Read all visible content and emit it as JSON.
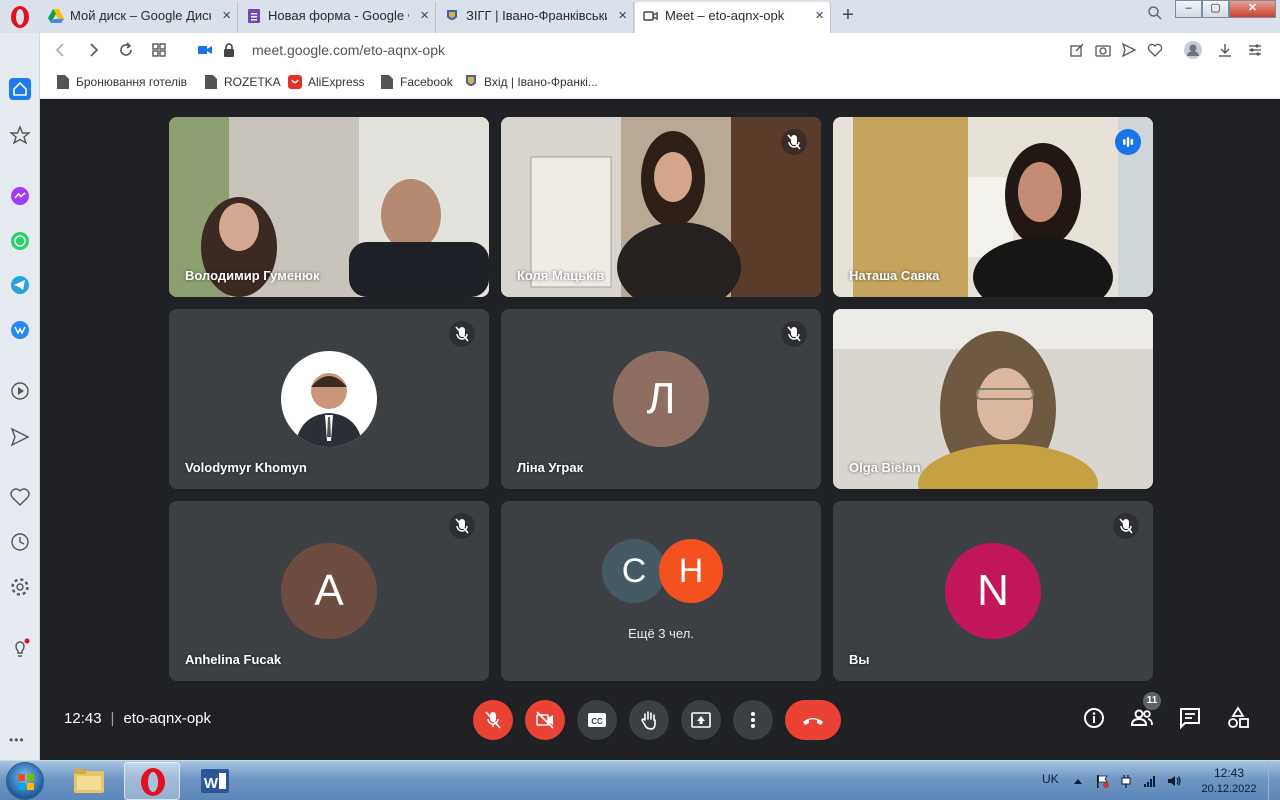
{
  "browser": {
    "tabs": [
      {
        "title": "Мой диск – Google Диск",
        "icon": "google-drive-icon",
        "active": false
      },
      {
        "title": "Новая форма - Google Фо",
        "icon": "google-forms-icon",
        "active": false
      },
      {
        "title": "ЗІГГ | Івано-Франківський",
        "icon": "crest-icon",
        "active": false
      },
      {
        "title": "Meet – eto-aqnx-opk",
        "icon": "meet-icon",
        "active": true
      }
    ],
    "close_glyph": "×",
    "new_tab_glyph": "+",
    "url": "meet.google.com/eto-aqnx-opk",
    "bookmarks": [
      {
        "label": "Бронювання готелів",
        "icon": "page-icon"
      },
      {
        "label": "ROZETKA",
        "icon": "page-icon"
      },
      {
        "label": "AliExpress",
        "icon": "aliexpress-icon"
      },
      {
        "label": "Facebook",
        "icon": "page-icon"
      },
      {
        "label": "Вхід | Івано-Франкі...",
        "icon": "crest-icon"
      }
    ],
    "window_buttons": {
      "minimize": "–",
      "maximize": "▢",
      "close": "✕"
    }
  },
  "sidebar": {
    "more_label": "•••"
  },
  "meet": {
    "participants": [
      {
        "name": "Володимир Гуменюк",
        "type": "video",
        "muted": false
      },
      {
        "name": "Коля Мацьків",
        "type": "video",
        "muted": true
      },
      {
        "name": "Наташа Савка",
        "type": "video",
        "speaking": true
      },
      {
        "name": "Volodymyr Khomyn",
        "type": "photo",
        "muted": true
      },
      {
        "name": "Ліна Уграк",
        "type": "avatar",
        "initial": "Л",
        "color": "#8d6e63",
        "muted": true
      },
      {
        "name": "Olga Bielan",
        "type": "video",
        "muted": false
      },
      {
        "name": "Anhelina Fucak",
        "type": "avatar",
        "initial": "A",
        "color": "#6d4c41",
        "muted": true
      },
      {
        "name": "",
        "type": "more",
        "initials": [
          "С",
          "Н"
        ],
        "colors": [
          "#455a64",
          "#f4511e"
        ],
        "label": "Ещё 3 чел."
      },
      {
        "name": "Вы",
        "type": "avatar",
        "initial": "N",
        "color": "#c2185b",
        "muted": true
      }
    ],
    "clock": "12:43",
    "meeting_code": "eto-aqnx-opk",
    "people_count": "11",
    "accent_red": "#ea4335",
    "accent_blue": "#8ab4f8"
  },
  "taskbar": {
    "language": "UK",
    "time": "12:43",
    "date": "20.12.2022"
  }
}
